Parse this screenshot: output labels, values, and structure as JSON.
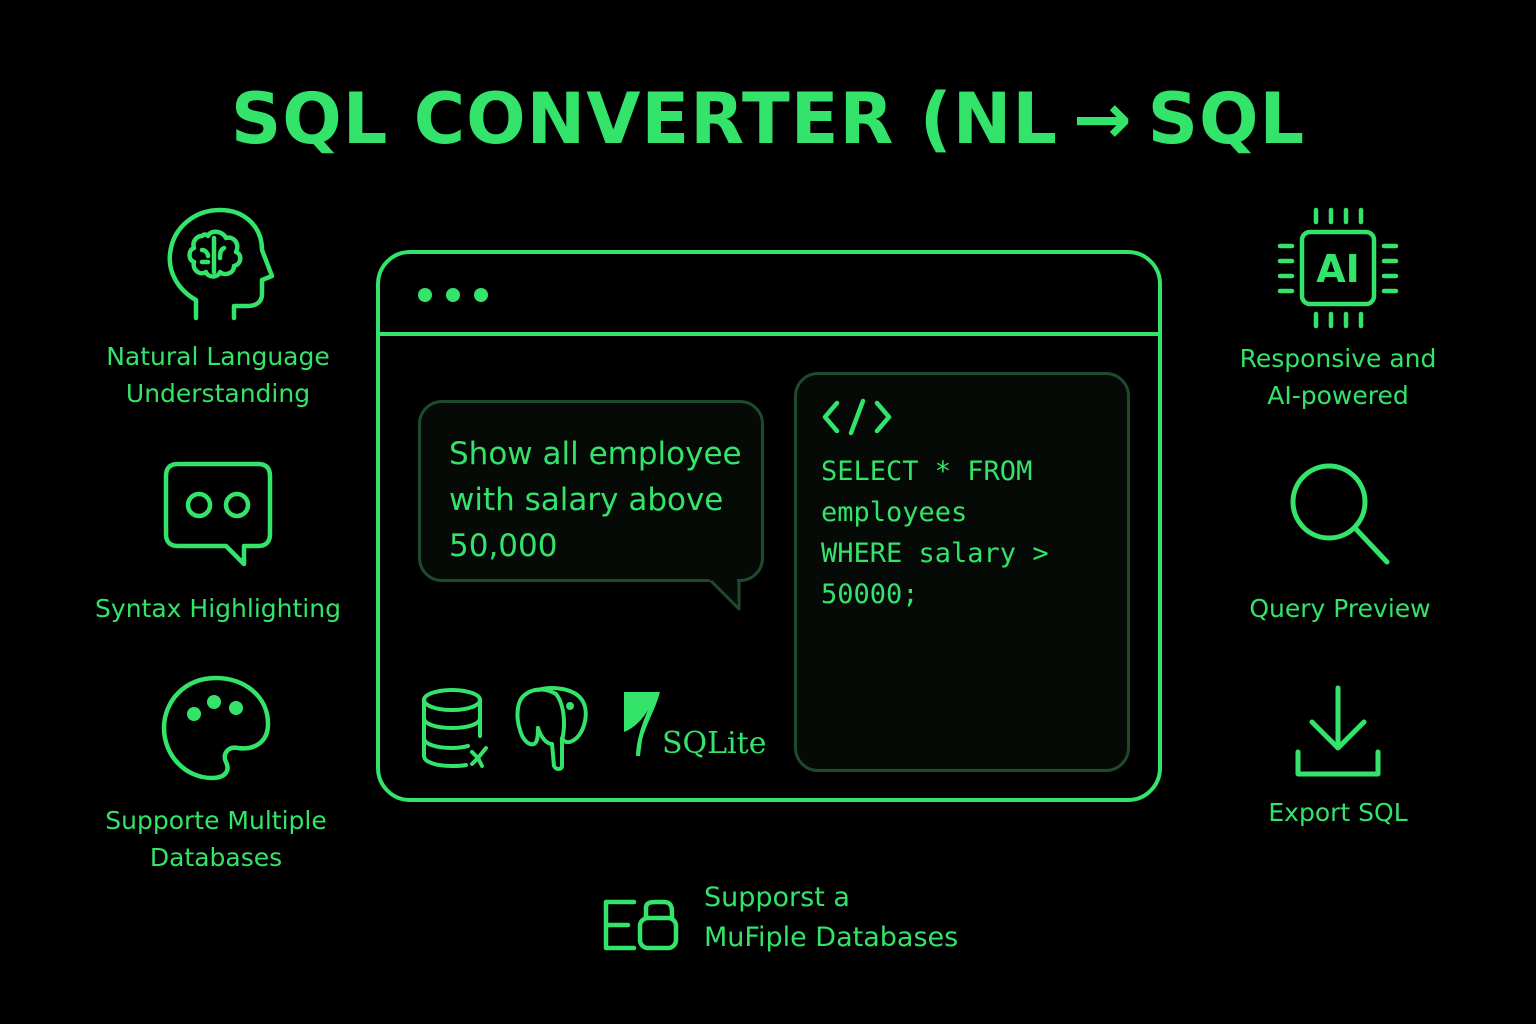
{
  "title": "SQL CONVERTER (NL → SQL",
  "features_left": [
    {
      "icon": "brain-head-icon",
      "label": "Natural Language\nUnderstanding"
    },
    {
      "icon": "speech-bubble-icon",
      "label": "Syntax Highlighting"
    },
    {
      "icon": "palette-icon",
      "label": "Supporte Multiple\nDatabases"
    }
  ],
  "features_right": [
    {
      "icon": "ai-chip-icon",
      "label": "Responsive and\nAI-powered"
    },
    {
      "icon": "magnifier-icon",
      "label": "Query Preview"
    },
    {
      "icon": "download-icon",
      "label": "Export SQL"
    }
  ],
  "window": {
    "input_text": "Show all employee\nwith salary above\n50,000",
    "code_icon": "code-brackets-icon",
    "sql_output": "SELECT * FROM\nemployees\nWHERE salary >\n50000;",
    "databases": [
      {
        "icon": "database-icon"
      },
      {
        "icon": "postgresql-elephant-icon"
      },
      {
        "icon": "sqlite-feather-icon",
        "label": "SQLite"
      }
    ]
  },
  "bottom_feature": {
    "icon": "database-connect-icon",
    "label": "Supporst a\nMuFiple Databases"
  },
  "colors": {
    "accent": "#34e36a",
    "background": "#000000",
    "panel_border": "#1e4a2c"
  }
}
